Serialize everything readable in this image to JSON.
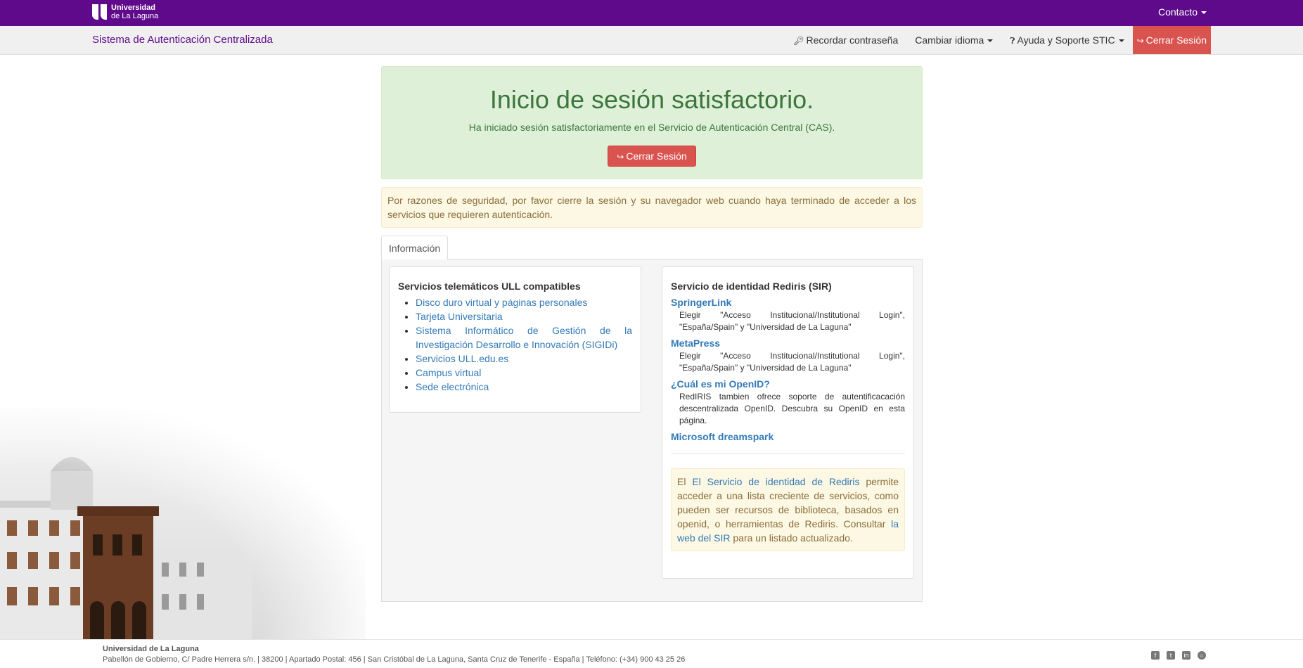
{
  "topbar": {
    "logo_line1": "Universidad",
    "logo_line2": "de La Laguna",
    "contacto": "Contacto"
  },
  "navbar": {
    "brand": "Sistema de Autenticación Centralizada",
    "recordar": "Recordar contraseña",
    "idioma": "Cambiar idioma",
    "ayuda": "Ayuda y Soporte STIC",
    "cerrar": "Cerrar Sesión"
  },
  "success": {
    "title": "Inicio de sesión satisfactorio.",
    "message": "Ha iniciado sesión satisfactoriamente en el Servicio de Autenticación Central (CAS).",
    "button": "Cerrar Sesión"
  },
  "warning": "Por razones de seguridad, por favor cierre la sesión y su navegador web cuando haya terminado de acceder a los servicios que requieren autenticación.",
  "tabs": [
    "Información"
  ],
  "services": {
    "title": "Servicios telemáticos ULL compatibles",
    "items": [
      "Disco duro virtual y páginas personales",
      "Tarjeta Universitaria",
      "Sistema Informático de Gestión de la Investigación Desarrollo e Innovación (SIGIDi)",
      "Servicios ULL.edu.es",
      "Campus virtual",
      "Sede electrónica"
    ]
  },
  "sir": {
    "title": "Servicio de identidad Rediris (SIR)",
    "items": [
      {
        "link": "SpringerLink",
        "desc": "Elegir \"Acceso Institucional/Institutional Login\", \"España/Spain\" y \"Universidad de La Laguna\""
      },
      {
        "link": "MetaPress",
        "desc": "Elegir \"Acceso Institucional/Institutional Login\", \"España/Spain\" y \"Universidad de La Laguna\""
      },
      {
        "link": "¿Cuál es mi OpenID?",
        "desc": "RedIRIS tambien ofrece soporte de autentificacación descentralizada OpenID. Descubra su OpenID en esta página."
      },
      {
        "link": "Microsoft dreamspark",
        "desc": ""
      }
    ],
    "note_prefix": "El ",
    "note_link1": "El Servicio de identidad de Rediris",
    "note_mid": " permite acceder a una lista creciente de servicios, como pueden ser recursos de biblioteca, basados en openid, o herramientas de Rediris. Consultar ",
    "note_link2": "la web del SIR",
    "note_suffix": " para un listado actualizado."
  },
  "footer": {
    "name": "Universidad de La Laguna",
    "address": "Pabellón de Gobierno, C/ Padre Herrera s/n. | 38200 | Apartado Postal: 456 | San Cristóbal de La Laguna, Santa Cruz de Tenerife - España | Teléfono: (+34) 900 43 25 26",
    "social": [
      "facebook-icon",
      "twitter-icon",
      "linkedin-icon",
      "globe-icon"
    ]
  },
  "colors": {
    "brand_purple": "#5e0a8b",
    "danger": "#d9534f",
    "success_bg": "#dff0d8",
    "warning_bg": "#fcf8e3"
  }
}
